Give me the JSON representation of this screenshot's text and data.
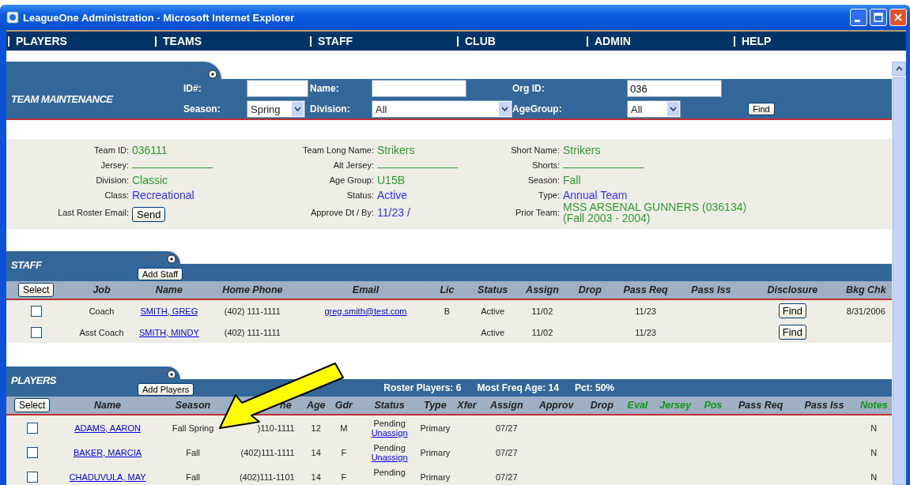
{
  "window": {
    "title": "LeagueOne Administration - Microsoft Internet Explorer"
  },
  "nav": [
    "PLAYERS",
    "TEAMS",
    "STAFF",
    "CLUB",
    "ADMIN",
    "HELP"
  ],
  "search": {
    "title": "TEAM MAINTENANCE",
    "button": "Find",
    "rows": [
      [
        {
          "label": "ID#:",
          "kind": "text"
        },
        {
          "label": "Name:",
          "kind": "text"
        },
        {
          "label": "Org ID:",
          "kind": "text",
          "value": "036"
        }
      ],
      [
        {
          "label": "Season:",
          "kind": "select",
          "value": "Spring"
        },
        {
          "label": "Division:",
          "kind": "select",
          "value": "All"
        },
        {
          "label": "AgeGroup:",
          "kind": "select",
          "value": "All"
        }
      ]
    ]
  },
  "team_info": [
    [
      {
        "label": "Team ID:",
        "kind": "text",
        "value": "036111",
        "color": "#339933"
      },
      {
        "label": "Jersey:",
        "kind": "blank"
      },
      {
        "label": "Division:",
        "kind": "text",
        "value": "Classic",
        "color": "#339933"
      },
      {
        "label": "Class:",
        "kind": "text",
        "value": "Recreational",
        "color": "#3333ff"
      },
      {
        "label": "Last Roster Email:",
        "kind": "button",
        "value": "Send"
      }
    ],
    [
      {
        "label": "Team Long Name:",
        "kind": "text",
        "value": "Strikers",
        "color": "#339933"
      },
      {
        "label": "Alt Jersey:",
        "kind": "blank"
      },
      {
        "label": "Age Group:",
        "kind": "text",
        "value": "U15B",
        "color": "#339933"
      },
      {
        "label": "Status:",
        "kind": "text",
        "value": "Active",
        "color": "#3333ff"
      },
      {
        "label": "Approve Dt / By:",
        "kind": "text",
        "value": "11/23 /",
        "color": "#3333ff"
      }
    ],
    [
      {
        "label": "Short Name:",
        "kind": "text",
        "value": "Strikers",
        "color": "#339933"
      },
      {
        "label": "Shorts:",
        "kind": "blank"
      },
      {
        "label": "Season:",
        "kind": "text",
        "value": "Fall",
        "color": "#339933"
      },
      {
        "label": "Type:",
        "kind": "text",
        "value": "Annual Team",
        "color": "#3333ff"
      },
      {
        "label": "Prior Team:",
        "kind": "text",
        "value": "MSS ARSENAL GUNNERS (036134) (Fall 2003 - 2004)",
        "color": "#339933"
      }
    ]
  ],
  "staff": {
    "title": "STAFF",
    "add_button": "Add Staff",
    "select_button": "Select",
    "columns": [
      {
        "label": "Job"
      },
      {
        "label": "Name"
      },
      {
        "label": "Home Phone"
      },
      {
        "label": "Email"
      },
      {
        "label": "Lic"
      },
      {
        "label": "Status"
      },
      {
        "label": "Assign"
      },
      {
        "label": "Drop"
      },
      {
        "label": "Pass Req"
      },
      {
        "label": "Pass Iss"
      },
      {
        "label": "Disclosure"
      },
      {
        "label": "Bkg Chk"
      }
    ],
    "rows": [
      {
        "checked": false,
        "cells": [
          {
            "kind": "text",
            "text": "Coach"
          },
          {
            "kind": "link",
            "text": "SMITH, GREG"
          },
          {
            "kind": "text",
            "text": "(402) 111-1111"
          },
          {
            "kind": "link",
            "text": "greg.smith@test.com"
          },
          {
            "kind": "text",
            "text": "B"
          },
          {
            "kind": "text",
            "text": "Active"
          },
          {
            "kind": "text",
            "text": "11/02"
          },
          {
            "kind": "text",
            "text": ""
          },
          {
            "kind": "text",
            "text": "11/23"
          },
          {
            "kind": "text",
            "text": ""
          },
          {
            "kind": "button",
            "text": "Find"
          },
          {
            "kind": "text",
            "text": "8/31/2006"
          }
        ]
      },
      {
        "checked": false,
        "cells": [
          {
            "kind": "text",
            "text": "Asst Coach"
          },
          {
            "kind": "link",
            "text": "SMITH, MINDY"
          },
          {
            "kind": "text",
            "text": "(402) 111-1111"
          },
          {
            "kind": "text",
            "text": ""
          },
          {
            "kind": "text",
            "text": ""
          },
          {
            "kind": "text",
            "text": "Active"
          },
          {
            "kind": "text",
            "text": "11/02"
          },
          {
            "kind": "text",
            "text": ""
          },
          {
            "kind": "text",
            "text": "11/23"
          },
          {
            "kind": "text",
            "text": ""
          },
          {
            "kind": "button",
            "text": "Find"
          },
          {
            "kind": "text",
            "text": ""
          }
        ]
      }
    ]
  },
  "players": {
    "title": "PLAYERS",
    "add_button": "Add Players",
    "select_button": "Select",
    "summary": [
      "Roster Players: 6",
      "Most Freq Age: 14",
      "Pct: 50%"
    ],
    "columns": [
      {
        "label": "Name",
        "color": "#222222"
      },
      {
        "label": "Season",
        "color": "#222222"
      },
      {
        "label": "ne",
        "color": "#222222"
      },
      {
        "label": "Age",
        "color": "#222222"
      },
      {
        "label": "Gdr",
        "color": "#222222"
      },
      {
        "label": "Status",
        "color": "#222222"
      },
      {
        "label": "Type",
        "color": "#222222"
      },
      {
        "label": "Xfer",
        "color": "#222222"
      },
      {
        "label": "Assign",
        "color": "#222222"
      },
      {
        "label": "Approv",
        "color": "#222222"
      },
      {
        "label": "Drop",
        "color": "#222222"
      },
      {
        "label": "Eval",
        "color": "#119911"
      },
      {
        "label": "Jersey",
        "color": "#119911"
      },
      {
        "label": "Pos",
        "color": "#119911"
      },
      {
        "label": "Pass Req",
        "color": "#222222"
      },
      {
        "label": "Pass Iss",
        "color": "#222222"
      },
      {
        "label": "Notes",
        "color": "#119911"
      }
    ],
    "rows": [
      {
        "checked": false,
        "cells": [
          {
            "kind": "link",
            "text": "ADAMS, AARON"
          },
          {
            "kind": "text",
            "text": "Fall Spring"
          },
          {
            "kind": "text",
            "text": ")110-1111"
          },
          {
            "kind": "text",
            "text": "12"
          },
          {
            "kind": "text",
            "text": "M"
          },
          {
            "kind": "status",
            "text": "Pending",
            "link": "Unassign"
          },
          {
            "kind": "text",
            "text": "Primary"
          },
          {
            "kind": "text",
            "text": ""
          },
          {
            "kind": "text",
            "text": "07/27"
          },
          {
            "kind": "text",
            "text": ""
          },
          {
            "kind": "text",
            "text": ""
          },
          {
            "kind": "text",
            "text": ""
          },
          {
            "kind": "text",
            "text": ""
          },
          {
            "kind": "text",
            "text": ""
          },
          {
            "kind": "text",
            "text": ""
          },
          {
            "kind": "text",
            "text": ""
          },
          {
            "kind": "text",
            "text": "N"
          }
        ]
      },
      {
        "checked": false,
        "cells": [
          {
            "kind": "link",
            "text": "BAKER, MARCIA"
          },
          {
            "kind": "text",
            "text": "Fall"
          },
          {
            "kind": "text",
            "text": "(402)111-1111"
          },
          {
            "kind": "text",
            "text": "14"
          },
          {
            "kind": "text",
            "text": "F"
          },
          {
            "kind": "status",
            "text": "Pending",
            "link": "Unassign"
          },
          {
            "kind": "text",
            "text": "Primary"
          },
          {
            "kind": "text",
            "text": ""
          },
          {
            "kind": "text",
            "text": "07/27"
          },
          {
            "kind": "text",
            "text": ""
          },
          {
            "kind": "text",
            "text": ""
          },
          {
            "kind": "text",
            "text": ""
          },
          {
            "kind": "text",
            "text": ""
          },
          {
            "kind": "text",
            "text": ""
          },
          {
            "kind": "text",
            "text": ""
          },
          {
            "kind": "text",
            "text": ""
          },
          {
            "kind": "text",
            "text": "N"
          }
        ]
      },
      {
        "checked": false,
        "cells": [
          {
            "kind": "link",
            "text": "CHADUVULA, MAY"
          },
          {
            "kind": "text",
            "text": "Fall"
          },
          {
            "kind": "text",
            "text": "(402)111-1101"
          },
          {
            "kind": "text",
            "text": "14"
          },
          {
            "kind": "text",
            "text": "F"
          },
          {
            "kind": "status",
            "text": "Pending"
          },
          {
            "kind": "text",
            "text": "Primary"
          },
          {
            "kind": "text",
            "text": ""
          },
          {
            "kind": "text",
            "text": "07/27"
          },
          {
            "kind": "text",
            "text": ""
          },
          {
            "kind": "text",
            "text": ""
          },
          {
            "kind": "text",
            "text": ""
          },
          {
            "kind": "text",
            "text": ""
          },
          {
            "kind": "text",
            "text": ""
          },
          {
            "kind": "text",
            "text": ""
          },
          {
            "kind": "text",
            "text": ""
          },
          {
            "kind": "text",
            "text": "N"
          }
        ]
      }
    ]
  }
}
